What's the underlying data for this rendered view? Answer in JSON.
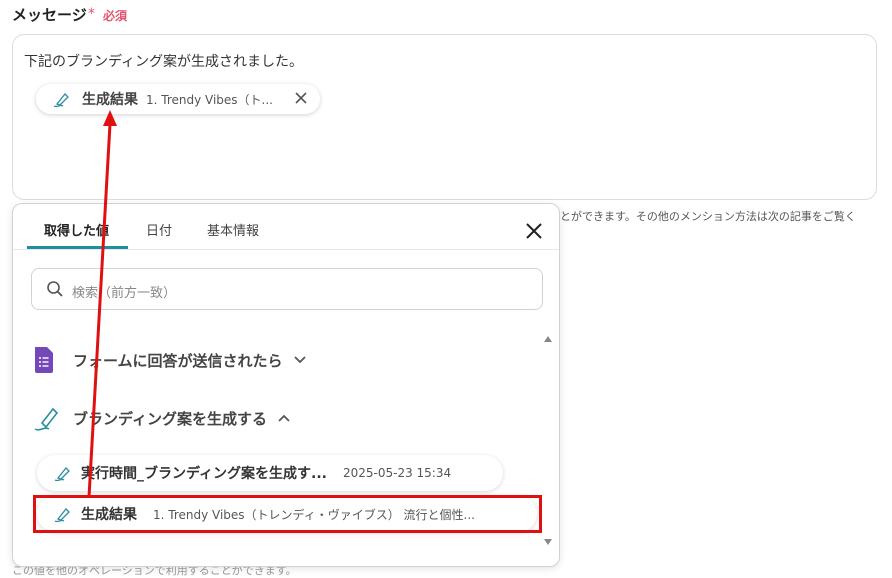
{
  "field": {
    "label": "メッセージ",
    "required_star": "*",
    "required_text": "必須"
  },
  "message": {
    "text": "下記のブランディング案が生成されました。",
    "chip": {
      "name": "生成結果",
      "value": "1. Trendy Vibes（ト..."
    }
  },
  "background": {
    "help_text": "とができます。その他のメンション方法は次の記事をご覧く",
    "bottom_text": "この値を他のオペレーションで利用することができます。"
  },
  "panel": {
    "tabs": [
      {
        "label": "取得した値",
        "active": true
      },
      {
        "label": "日付",
        "active": false
      },
      {
        "label": "基本情報",
        "active": false
      }
    ],
    "search_placeholder": "検索（前方一致）",
    "sections": [
      {
        "label": "フォームに回答が送信されたら",
        "expanded": false,
        "icon": "google-forms-icon"
      },
      {
        "label": "ブランディング案を生成する",
        "expanded": true,
        "icon": "ai-pen-icon"
      }
    ],
    "items": [
      {
        "name": "実行時間_ブランディング案を生成す...",
        "value": "2025-05-23 15:34"
      },
      {
        "name": "生成結果",
        "value": "1. Trendy Vibes（トレンディ・ヴァイブス） 流行と個性..."
      }
    ]
  },
  "colors": {
    "accent": "#1f8ea0",
    "required": "#e0566b",
    "annotation": "#e01010",
    "forms_purple": "#7448b8"
  }
}
